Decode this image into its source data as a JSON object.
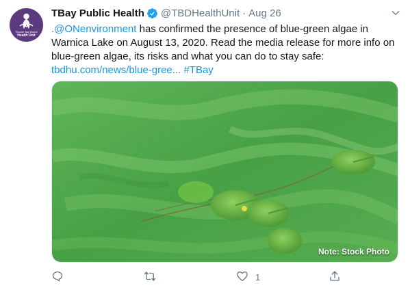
{
  "tweet": {
    "display_name": "TBay Public Health",
    "handle": "@TBDHealthUnit",
    "separator": "·",
    "timestamp": "Aug 26",
    "text_mention": ".@ONenvironment",
    "text_body": " has confirmed the presence of blue-green algae in Warnica Lake on August 13, 2020. Read the media release for more info on blue-green algae, its risks and what you can do to stay safe: ",
    "text_link": "tbdhu.com/news/blue-gree...",
    "text_space": " ",
    "text_hashtag": "#TBay",
    "avatar_label": "Thunder Bay District Health Unit",
    "media_caption": "Note: Stock Photo",
    "like_count": "1"
  },
  "colors": {
    "link": "#1b95e0",
    "verified": "#1da1f2",
    "muted": "#657786",
    "avatar_bg": "#5b3a7e",
    "water_green": "#4fa84a"
  },
  "icons": {
    "verified": "verified-badge-icon",
    "caret": "chevron-down-icon",
    "reply": "reply-icon",
    "retweet": "retweet-icon",
    "like": "heart-icon",
    "share": "share-icon"
  }
}
